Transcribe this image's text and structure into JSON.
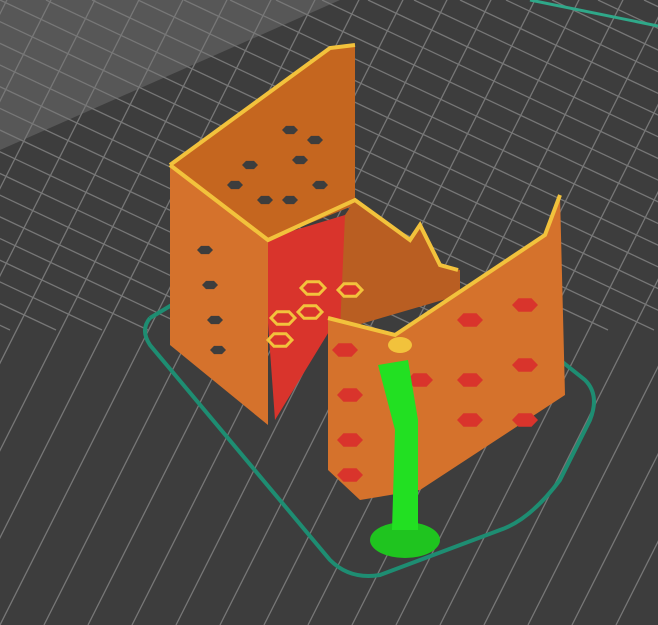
{
  "viewport": {
    "view": "3d-preview",
    "colors": {
      "background": "#3d3d3d",
      "outside_bed": "#575757",
      "grid_line": "#777777",
      "bed_edge": "#2fa889",
      "skirt": "#1e8d72",
      "wall": "#d5722c",
      "wall_dark": "#b95e22",
      "perimeter": "#f2c23c",
      "infill": "#d9342c",
      "support": "#22e022"
    }
  }
}
